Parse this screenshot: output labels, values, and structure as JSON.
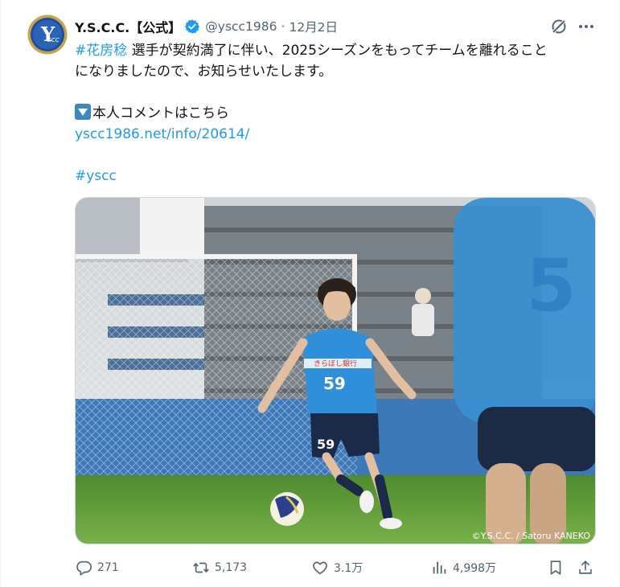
{
  "tweet": {
    "author": {
      "display_name": "Y.S.C.C.【公式】",
      "handle": "@yscc1986",
      "separator": "·",
      "date": "12月2日",
      "verified": true,
      "avatar_text": "YSCC"
    },
    "text": {
      "hashtag_player": "#花房稔",
      "line1_rest": " 選手が契約満了に伴い、2025シーズンをもってチームを離れること",
      "line2": "になりましたので、お知らせいたします。",
      "comment_label": "本人コメントはこちら",
      "link": "yscc1986.net/info/20614/",
      "hashtag_team": "#yscc"
    },
    "photo": {
      "jersey_number": "59",
      "sponsor": "きらぼし銀行",
      "credit": "©Y.S.C.C. / Satoru KANEKO"
    },
    "stats": {
      "replies": "271",
      "retweets": "5,173",
      "likes": "3.1万",
      "views": "4,998万"
    }
  },
  "icons": [
    "verified-badge-icon",
    "grok-icon",
    "more-icon",
    "reply-icon",
    "retweet-icon",
    "like-icon",
    "views-icon",
    "bookmark-icon",
    "share-icon"
  ],
  "colors": {
    "accent": "#1d9bf0",
    "secondary_text": "#536471",
    "primary_text": "#0f1419",
    "club_blue": "#3c9ee0",
    "club_gold": "#c9a24a"
  }
}
